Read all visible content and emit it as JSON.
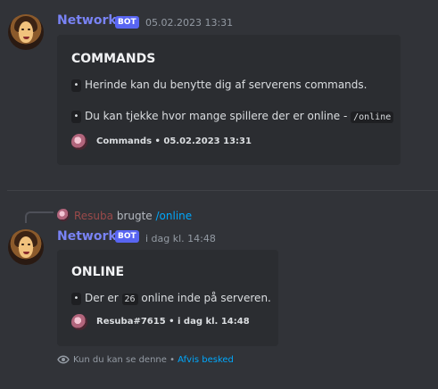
{
  "message1": {
    "username": "Network",
    "bot_tag": "BOT",
    "timestamp": "05.02.2023 13:31",
    "embed": {
      "title": "COMMANDS",
      "bullet": "•",
      "line1": "Herinde kan du benytte dig af serverens commands.",
      "line2_prefix": "Du kan tjekke hvor mange spillere der er online - ",
      "line2_code": "/online",
      "footer": "Commands • 05.02.2023 13:31"
    }
  },
  "message2": {
    "reply": {
      "user": "Resuba",
      "text": " brugte ",
      "command": "/online"
    },
    "username": "Network",
    "bot_tag": "BOT",
    "timestamp": "i dag kl. 14:48",
    "embed": {
      "title": "ONLINE",
      "bullet": "•",
      "prefix": "Der er ",
      "count": "26",
      "suffix": " online inde på serveren.",
      "footer": "Resuba#7615 • i dag kl. 14:48"
    },
    "ephemeral": {
      "text": "Kun du kan se denne • ",
      "dismiss": "Afvis besked"
    }
  }
}
